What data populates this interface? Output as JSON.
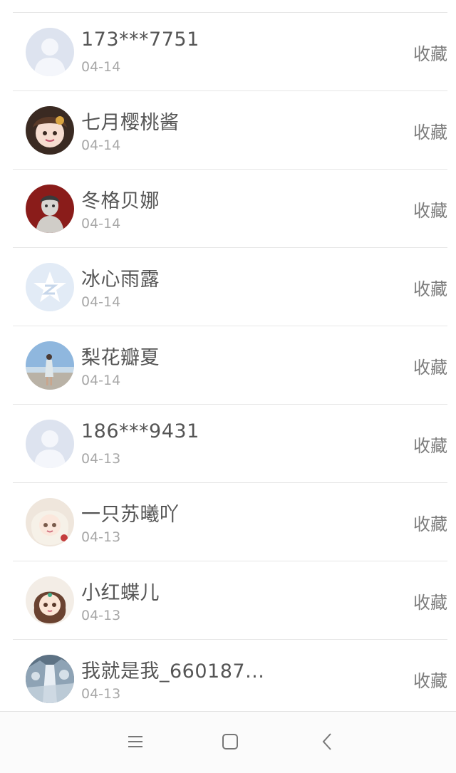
{
  "colors": {
    "divider": "#e6e6e6",
    "name_text": "#555555",
    "date_text": "#a7a7a7",
    "action_text": "#7d7d7d"
  },
  "items": [
    {
      "name": "173***7751",
      "date": "04-14",
      "action": "收藏",
      "avatar_icon": "default-user-avatar-icon"
    },
    {
      "name": "七月樱桃酱",
      "date": "04-14",
      "action": "收藏",
      "avatar_icon": "anime-girl-avatar-icon"
    },
    {
      "name": "冬格贝娜",
      "date": "04-14",
      "action": "收藏",
      "avatar_icon": "dark-red-portrait-avatar-icon"
    },
    {
      "name": "冰心雨露",
      "date": "04-14",
      "action": "收藏",
      "avatar_icon": "qzone-star-avatar-icon"
    },
    {
      "name": "梨花瓣夏",
      "date": "04-14",
      "action": "收藏",
      "avatar_icon": "seaside-girl-avatar-icon"
    },
    {
      "name": "186***9431",
      "date": "04-13",
      "action": "收藏",
      "avatar_icon": "default-user-avatar-icon"
    },
    {
      "name": "一只苏曦吖",
      "date": "04-13",
      "action": "收藏",
      "avatar_icon": "anime-girl-avatar-icon"
    },
    {
      "name": "小红蝶儿",
      "date": "04-13",
      "action": "收藏",
      "avatar_icon": "chibi-girl-avatar-icon"
    },
    {
      "name": "我就是我_660187...",
      "date": "04-13",
      "action": "收藏",
      "avatar_icon": "waterfall-avatar-icon"
    }
  ],
  "navbar": {
    "menu_icon": "menu-icon",
    "home_icon": "home-square-icon",
    "back_icon": "back-chevron-icon"
  }
}
